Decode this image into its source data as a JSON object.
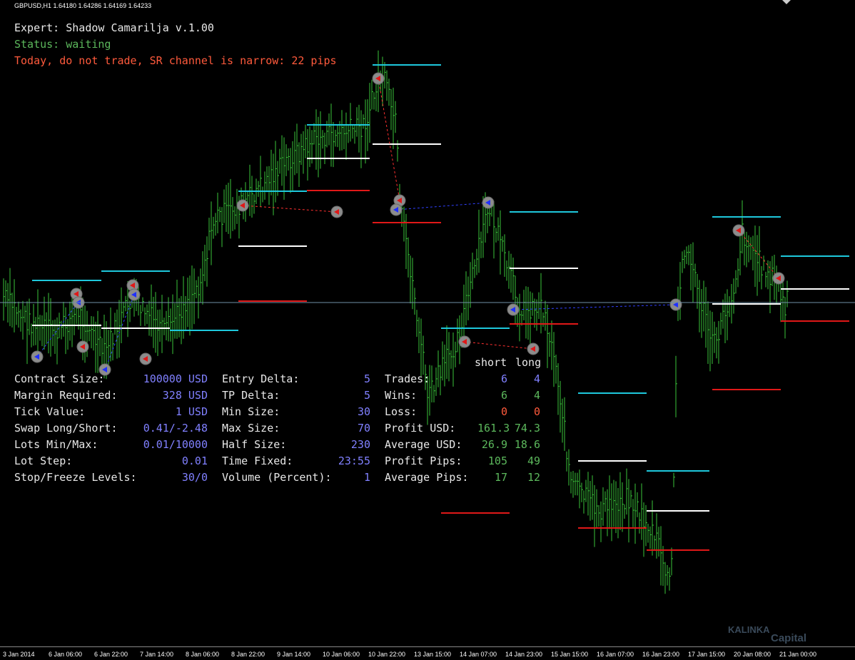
{
  "window": {
    "symbol_ohlc": "GBPUSD,H1  1.64180 1.64286 1.64169 1.64233"
  },
  "status": {
    "expert": "Expert: Shadow Camarilja v.1.00",
    "state": "Status: waiting",
    "message": "Today, do not trade, SR channel is narrow: 22 pips"
  },
  "colors": {
    "accent_value": "#8080ff",
    "positive": "#5cb85c",
    "negative": "#ff5a3c",
    "candle": "#3ac43a",
    "resistance": "#1ec8dc",
    "support": "#e01818",
    "pivot": "#ffffff",
    "grid": "#6f8fa6"
  },
  "contract_table": [
    {
      "label": "Contract Size:",
      "value": "100000 USD"
    },
    {
      "label": "Margin Required:",
      "value": "328 USD"
    },
    {
      "label": "Tick Value:",
      "value": "1 USD"
    },
    {
      "label": "Swap Long/Short:",
      "value": "0.41/-2.48"
    },
    {
      "label": "Lots Min/Max:",
      "value": "0.01/10000"
    },
    {
      "label": "Lot Step:",
      "value": "0.01"
    },
    {
      "label": "Stop/Freeze Levels:",
      "value": "30/0"
    }
  ],
  "settings_table": [
    {
      "label": "Entry Delta:",
      "value": "5"
    },
    {
      "label": "TP Delta:",
      "value": "5"
    },
    {
      "label": "Min Size:",
      "value": "30"
    },
    {
      "label": "Max Size:",
      "value": "70"
    },
    {
      "label": "Half Size:",
      "value": "230"
    },
    {
      "label": "Time Fixed:",
      "value": "23:55"
    },
    {
      "label": "Volume (Percent):",
      "value": "1"
    }
  ],
  "stats_table": {
    "headers": [
      "short",
      "long"
    ],
    "rows": [
      {
        "label": "Trades:",
        "short": "6",
        "long": "4",
        "tone": "accent"
      },
      {
        "label": "Wins:",
        "short": "6",
        "long": "4",
        "tone": "positive"
      },
      {
        "label": "Loss:",
        "short": "0",
        "long": "0",
        "tone": "negative"
      },
      {
        "label": "Profit USD:",
        "short": "161.3",
        "long": "74.3",
        "tone": "positive"
      },
      {
        "label": "Average USD:",
        "short": "26.9",
        "long": "18.6",
        "tone": "positive"
      },
      {
        "label": "Profit Pips:",
        "short": "105",
        "long": "49",
        "tone": "positive"
      },
      {
        "label": "Average Pips:",
        "short": "17",
        "long": "12",
        "tone": "positive"
      }
    ]
  },
  "time_axis": [
    "3 Jan 2014",
    "6 Jan 06:00",
    "6 Jan 22:00",
    "7 Jan 14:00",
    "8 Jan 06:00",
    "8 Jan 22:00",
    "9 Jan 14:00",
    "10 Jan 06:00",
    "10 Jan 22:00",
    "13 Jan 15:00",
    "14 Jan 07:00",
    "14 Jan 23:00",
    "15 Jan 15:00",
    "16 Jan 07:00",
    "16 Jan 23:00",
    "17 Jan 15:00",
    "20 Jan 08:00",
    "21 Jan 00:00"
  ],
  "branding": {
    "line1": "KALINKA",
    "line2": "Capital"
  }
}
